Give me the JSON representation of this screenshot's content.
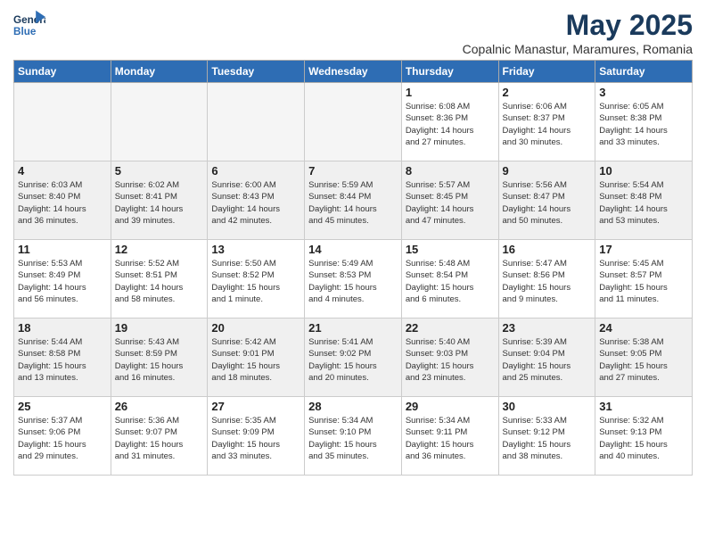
{
  "header": {
    "logo_general": "General",
    "logo_blue": "Blue",
    "month_title": "May 2025",
    "subtitle": "Copalnic Manastur, Maramures, Romania"
  },
  "days_of_week": [
    "Sunday",
    "Monday",
    "Tuesday",
    "Wednesday",
    "Thursday",
    "Friday",
    "Saturday"
  ],
  "weeks": [
    [
      {
        "day": "",
        "info": ""
      },
      {
        "day": "",
        "info": ""
      },
      {
        "day": "",
        "info": ""
      },
      {
        "day": "",
        "info": ""
      },
      {
        "day": "1",
        "info": "Sunrise: 6:08 AM\nSunset: 8:36 PM\nDaylight: 14 hours\nand 27 minutes."
      },
      {
        "day": "2",
        "info": "Sunrise: 6:06 AM\nSunset: 8:37 PM\nDaylight: 14 hours\nand 30 minutes."
      },
      {
        "day": "3",
        "info": "Sunrise: 6:05 AM\nSunset: 8:38 PM\nDaylight: 14 hours\nand 33 minutes."
      }
    ],
    [
      {
        "day": "4",
        "info": "Sunrise: 6:03 AM\nSunset: 8:40 PM\nDaylight: 14 hours\nand 36 minutes."
      },
      {
        "day": "5",
        "info": "Sunrise: 6:02 AM\nSunset: 8:41 PM\nDaylight: 14 hours\nand 39 minutes."
      },
      {
        "day": "6",
        "info": "Sunrise: 6:00 AM\nSunset: 8:43 PM\nDaylight: 14 hours\nand 42 minutes."
      },
      {
        "day": "7",
        "info": "Sunrise: 5:59 AM\nSunset: 8:44 PM\nDaylight: 14 hours\nand 45 minutes."
      },
      {
        "day": "8",
        "info": "Sunrise: 5:57 AM\nSunset: 8:45 PM\nDaylight: 14 hours\nand 47 minutes."
      },
      {
        "day": "9",
        "info": "Sunrise: 5:56 AM\nSunset: 8:47 PM\nDaylight: 14 hours\nand 50 minutes."
      },
      {
        "day": "10",
        "info": "Sunrise: 5:54 AM\nSunset: 8:48 PM\nDaylight: 14 hours\nand 53 minutes."
      }
    ],
    [
      {
        "day": "11",
        "info": "Sunrise: 5:53 AM\nSunset: 8:49 PM\nDaylight: 14 hours\nand 56 minutes."
      },
      {
        "day": "12",
        "info": "Sunrise: 5:52 AM\nSunset: 8:51 PM\nDaylight: 14 hours\nand 58 minutes."
      },
      {
        "day": "13",
        "info": "Sunrise: 5:50 AM\nSunset: 8:52 PM\nDaylight: 15 hours\nand 1 minute."
      },
      {
        "day": "14",
        "info": "Sunrise: 5:49 AM\nSunset: 8:53 PM\nDaylight: 15 hours\nand 4 minutes."
      },
      {
        "day": "15",
        "info": "Sunrise: 5:48 AM\nSunset: 8:54 PM\nDaylight: 15 hours\nand 6 minutes."
      },
      {
        "day": "16",
        "info": "Sunrise: 5:47 AM\nSunset: 8:56 PM\nDaylight: 15 hours\nand 9 minutes."
      },
      {
        "day": "17",
        "info": "Sunrise: 5:45 AM\nSunset: 8:57 PM\nDaylight: 15 hours\nand 11 minutes."
      }
    ],
    [
      {
        "day": "18",
        "info": "Sunrise: 5:44 AM\nSunset: 8:58 PM\nDaylight: 15 hours\nand 13 minutes."
      },
      {
        "day": "19",
        "info": "Sunrise: 5:43 AM\nSunset: 8:59 PM\nDaylight: 15 hours\nand 16 minutes."
      },
      {
        "day": "20",
        "info": "Sunrise: 5:42 AM\nSunset: 9:01 PM\nDaylight: 15 hours\nand 18 minutes."
      },
      {
        "day": "21",
        "info": "Sunrise: 5:41 AM\nSunset: 9:02 PM\nDaylight: 15 hours\nand 20 minutes."
      },
      {
        "day": "22",
        "info": "Sunrise: 5:40 AM\nSunset: 9:03 PM\nDaylight: 15 hours\nand 23 minutes."
      },
      {
        "day": "23",
        "info": "Sunrise: 5:39 AM\nSunset: 9:04 PM\nDaylight: 15 hours\nand 25 minutes."
      },
      {
        "day": "24",
        "info": "Sunrise: 5:38 AM\nSunset: 9:05 PM\nDaylight: 15 hours\nand 27 minutes."
      }
    ],
    [
      {
        "day": "25",
        "info": "Sunrise: 5:37 AM\nSunset: 9:06 PM\nDaylight: 15 hours\nand 29 minutes."
      },
      {
        "day": "26",
        "info": "Sunrise: 5:36 AM\nSunset: 9:07 PM\nDaylight: 15 hours\nand 31 minutes."
      },
      {
        "day": "27",
        "info": "Sunrise: 5:35 AM\nSunset: 9:09 PM\nDaylight: 15 hours\nand 33 minutes."
      },
      {
        "day": "28",
        "info": "Sunrise: 5:34 AM\nSunset: 9:10 PM\nDaylight: 15 hours\nand 35 minutes."
      },
      {
        "day": "29",
        "info": "Sunrise: 5:34 AM\nSunset: 9:11 PM\nDaylight: 15 hours\nand 36 minutes."
      },
      {
        "day": "30",
        "info": "Sunrise: 5:33 AM\nSunset: 9:12 PM\nDaylight: 15 hours\nand 38 minutes."
      },
      {
        "day": "31",
        "info": "Sunrise: 5:32 AM\nSunset: 9:13 PM\nDaylight: 15 hours\nand 40 minutes."
      }
    ]
  ]
}
